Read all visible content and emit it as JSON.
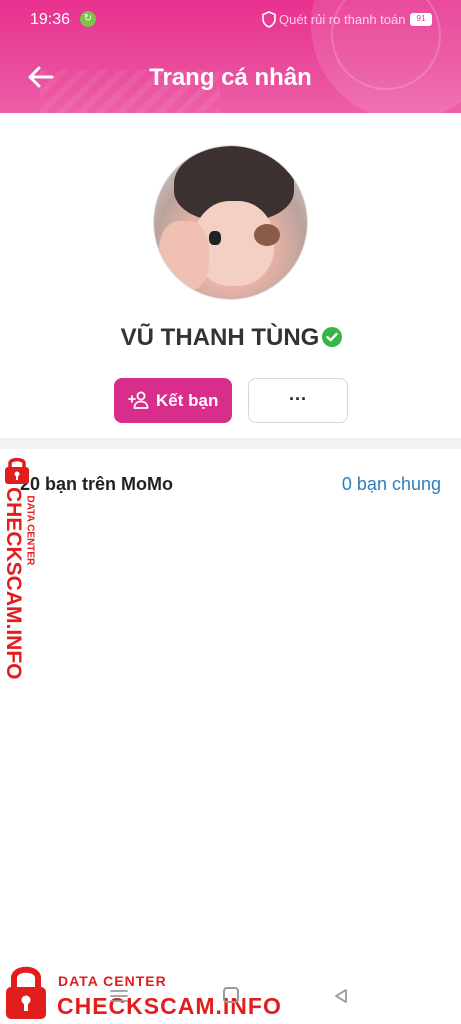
{
  "status_bar": {
    "time": "19:36",
    "app_icon": "momo-status-icon",
    "notification_text": "Quét rủi ro thanh toán",
    "battery_level": "91"
  },
  "header": {
    "title": "Trang cá nhân",
    "back_icon": "arrow-left-icon"
  },
  "profile": {
    "name": "VŨ THANH TÙNG",
    "verified": true,
    "avatar": "profile-photo"
  },
  "actions": {
    "add_friend_label": "Kết bạn",
    "add_friend_icon": "person-add-icon",
    "more_label": "···"
  },
  "friends": {
    "count_label": "20 bạn trên MoMo",
    "mutual_label": "0 bạn chung"
  },
  "watermark": {
    "main": "CHECKSCAM.INFO",
    "sub": "DATA CENTER"
  },
  "nav_bar": {
    "items": [
      "menu-icon",
      "home-icon",
      "back-triangle-icon"
    ]
  },
  "colors": {
    "header_pink": "#e8318f",
    "button_pink": "#d82d8b",
    "link_blue": "#2a7fbf",
    "verified_green": "#38b449",
    "watermark_red": "#e21d1d"
  }
}
